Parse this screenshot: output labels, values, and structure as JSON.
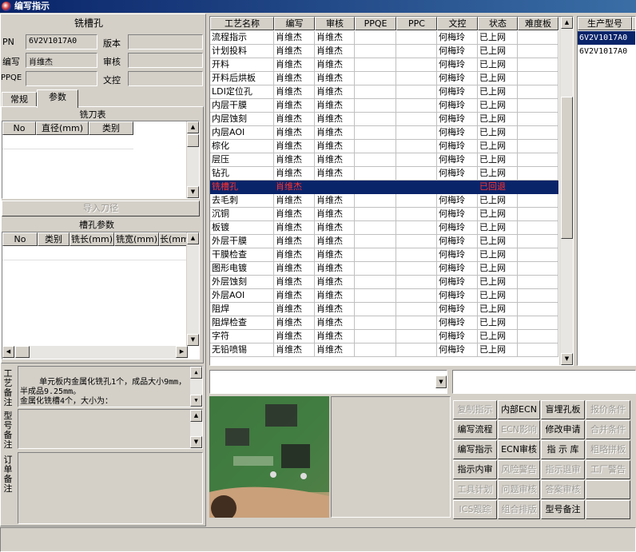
{
  "window": {
    "title": "编写指示"
  },
  "left": {
    "header": "铣槽孔",
    "fields": {
      "pn_label": "PN",
      "pn_value": "6V2V1017A0",
      "version_label": "版本",
      "version_value": "",
      "writer_label": "编写",
      "writer_value": "肖维杰",
      "review_label": "审核",
      "review_value": "",
      "ppqe_label": "PPQE",
      "ppqe_value": "",
      "doccontrol_label": "文控",
      "doccontrol_value": ""
    },
    "tabs": [
      "常规",
      "参数"
    ],
    "cutter_table": {
      "title": "铣刀表",
      "headers": [
        "No",
        "直径(mm)",
        "类别"
      ]
    },
    "import_button": "导入刀径",
    "slot_params": {
      "title": "槽孔参数",
      "headers": [
        "No",
        "类别",
        "铣长(mm)",
        "铣宽(mm)",
        "长(mm"
      ]
    },
    "process_note_label": "工艺备注",
    "process_note_text": "单元板内金属化铣孔1个，成品大小9mm，半成品9.25mm。\n金属化铣槽4个，大小为：",
    "model_note_label": "型号备注",
    "order_note_label": "订单备注"
  },
  "grid": {
    "headers": [
      "工艺名称",
      "编写",
      "审核",
      "PPQE",
      "PPC",
      "文控",
      "状态",
      "难度板"
    ],
    "rows": [
      [
        "流程指示",
        "肖维杰",
        "肖维杰",
        "",
        "",
        "何梅玲",
        "已上网",
        ""
      ],
      [
        "计划投料",
        "肖维杰",
        "肖维杰",
        "",
        "",
        "何梅玲",
        "已上网",
        ""
      ],
      [
        "开料",
        "肖维杰",
        "肖维杰",
        "",
        "",
        "何梅玲",
        "已上网",
        ""
      ],
      [
        "开料后烘板",
        "肖维杰",
        "肖维杰",
        "",
        "",
        "何梅玲",
        "已上网",
        ""
      ],
      [
        "LDI定位孔",
        "肖维杰",
        "肖维杰",
        "",
        "",
        "何梅玲",
        "已上网",
        ""
      ],
      [
        "内层干膜",
        "肖维杰",
        "肖维杰",
        "",
        "",
        "何梅玲",
        "已上网",
        ""
      ],
      [
        "内层蚀刻",
        "肖维杰",
        "肖维杰",
        "",
        "",
        "何梅玲",
        "已上网",
        ""
      ],
      [
        "内层AOI",
        "肖维杰",
        "肖维杰",
        "",
        "",
        "何梅玲",
        "已上网",
        ""
      ],
      [
        "棕化",
        "肖维杰",
        "肖维杰",
        "",
        "",
        "何梅玲",
        "已上网",
        ""
      ],
      [
        "层压",
        "肖维杰",
        "肖维杰",
        "",
        "",
        "何梅玲",
        "已上网",
        ""
      ],
      [
        "钻孔",
        "肖维杰",
        "肖维杰",
        "",
        "",
        "何梅玲",
        "已上网",
        ""
      ],
      [
        "铣槽孔",
        "肖维杰",
        "",
        "",
        "",
        "",
        "已回退",
        ""
      ],
      [
        "去毛刺",
        "肖维杰",
        "肖维杰",
        "",
        "",
        "何梅玲",
        "已上网",
        ""
      ],
      [
        "沉铜",
        "肖维杰",
        "肖维杰",
        "",
        "",
        "何梅玲",
        "已上网",
        ""
      ],
      [
        "板镀",
        "肖维杰",
        "肖维杰",
        "",
        "",
        "何梅玲",
        "已上网",
        ""
      ],
      [
        "外层干膜",
        "肖维杰",
        "肖维杰",
        "",
        "",
        "何梅玲",
        "已上网",
        ""
      ],
      [
        "干膜检查",
        "肖维杰",
        "肖维杰",
        "",
        "",
        "何梅玲",
        "已上网",
        ""
      ],
      [
        "图形电镀",
        "肖维杰",
        "肖维杰",
        "",
        "",
        "何梅玲",
        "已上网",
        ""
      ],
      [
        "外层蚀刻",
        "肖维杰",
        "肖维杰",
        "",
        "",
        "何梅玲",
        "已上网",
        ""
      ],
      [
        "外层AOI",
        "肖维杰",
        "肖维杰",
        "",
        "",
        "何梅玲",
        "已上网",
        ""
      ],
      [
        "阻焊",
        "肖维杰",
        "肖维杰",
        "",
        "",
        "何梅玲",
        "已上网",
        ""
      ],
      [
        "阻焊检查",
        "肖维杰",
        "肖维杰",
        "",
        "",
        "何梅玲",
        "已上网",
        ""
      ],
      [
        "字符",
        "肖维杰",
        "肖维杰",
        "",
        "",
        "何梅玲",
        "已上网",
        ""
      ],
      [
        "无铅喷锡",
        "肖维杰",
        "肖维杰",
        "",
        "",
        "何梅玲",
        "已上网",
        ""
      ]
    ],
    "selected_row": 11,
    "selected_color": "#0a246a",
    "selected_text_color": "#ff3030"
  },
  "model_list": {
    "header": "生产型号",
    "items": [
      "6V2V1017A0",
      "6V2V1017A0"
    ]
  },
  "buttons": [
    {
      "label": "复制指示",
      "enabled": false
    },
    {
      "label": "内部ECN",
      "enabled": true
    },
    {
      "label": "盲埋孔板",
      "enabled": true
    },
    {
      "label": "报价条件",
      "enabled": false
    },
    {
      "label": "编写流程",
      "enabled": true
    },
    {
      "label": "ECN影响",
      "enabled": false
    },
    {
      "label": "修改申请",
      "enabled": true
    },
    {
      "label": "合并条件",
      "enabled": false
    },
    {
      "label": "编写指示",
      "enabled": true
    },
    {
      "label": "ECN审核",
      "enabled": true
    },
    {
      "label": "指 示 库",
      "enabled": true
    },
    {
      "label": "粗略拼板",
      "enabled": false
    },
    {
      "label": "指示内审",
      "enabled": true
    },
    {
      "label": "风险警告",
      "enabled": false
    },
    {
      "label": "指示退审",
      "enabled": false
    },
    {
      "label": "工厂警告",
      "enabled": false
    },
    {
      "label": "工具计划",
      "enabled": false
    },
    {
      "label": "问题审核",
      "enabled": false
    },
    {
      "label": "答案审核",
      "enabled": false
    },
    {
      "label": "",
      "enabled": false
    },
    {
      "label": "ICS跟踪",
      "enabled": false
    },
    {
      "label": "组合排版",
      "enabled": false
    },
    {
      "label": "型号备注",
      "enabled": true
    },
    {
      "label": "",
      "enabled": false
    }
  ]
}
